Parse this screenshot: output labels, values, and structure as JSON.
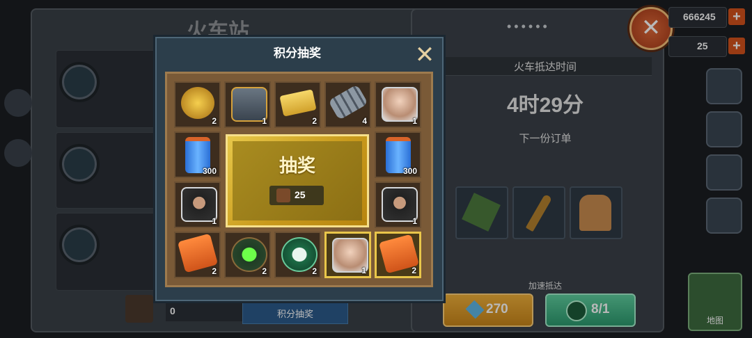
{
  "background": {
    "station_title": "火车站",
    "train_arrival_label": "火车抵达时间",
    "train_arrival_time": "4时29分",
    "next_order_label": "下一份订单",
    "speed_up_label": "加速抵达",
    "speed_up_cost": "270",
    "ticket_count": "8/1",
    "bottom_points": "0",
    "bottom_button_label": "积分抽奖",
    "currency_1": "666245",
    "currency_2": "25",
    "dots": "••••••",
    "map_label": "地图"
  },
  "modal": {
    "title": "积分抽奖",
    "close_glyph": "✕",
    "draw_label": "抽奖",
    "draw_cost": "25"
  },
  "grid": {
    "top": [
      {
        "name": "radar-dish",
        "qty": "2"
      },
      {
        "name": "machine-parts",
        "qty": "1"
      },
      {
        "name": "train-ticket",
        "qty": "2"
      },
      {
        "name": "rail-track",
        "qty": "4"
      },
      {
        "name": "old-man-portrait",
        "qty": "1"
      }
    ],
    "left": [
      {
        "name": "energy-battery",
        "qty": "300"
      },
      {
        "name": "soldier-portrait",
        "qty": "1"
      }
    ],
    "right": [
      {
        "name": "energy-battery",
        "qty": "300"
      },
      {
        "name": "soldier-portrait",
        "qty": "1"
      }
    ],
    "bottom": [
      {
        "name": "timer-device",
        "qty": "2"
      },
      {
        "name": "medical-cross",
        "qty": "2"
      },
      {
        "name": "train-token",
        "qty": "2"
      },
      {
        "name": "old-man-portrait",
        "qty": "1"
      },
      {
        "name": "timer-device",
        "qty": "2"
      }
    ]
  },
  "colors": {
    "board": "#7a5a37",
    "highlight": "#e9c64a",
    "modal_bg": "#2c3e4b",
    "gold": "#d4a72a"
  }
}
